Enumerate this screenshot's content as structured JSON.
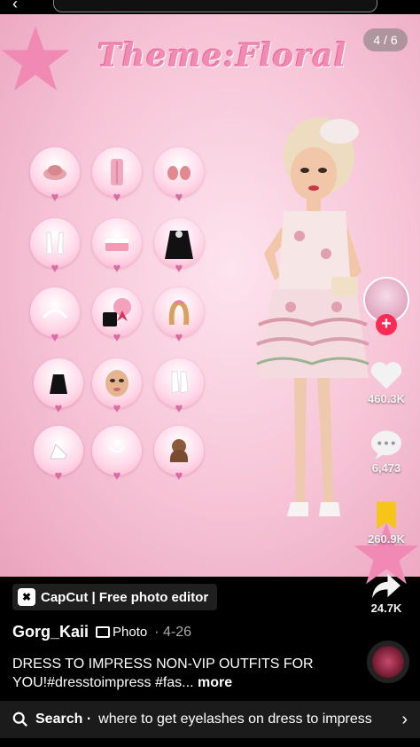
{
  "post": {
    "theme_title": "Theme:Floral",
    "page_counter": "4 / 6",
    "carousel_dots": 6,
    "carousel_active_index": 3
  },
  "rail": {
    "likes": "460.3K",
    "comments": "6,473",
    "saves": "260.9K",
    "shares": "24.7K"
  },
  "attribution": {
    "app_label": "CapCut | Free photo editor"
  },
  "meta": {
    "username": "Gorg_Kaii",
    "type_label": "Photo",
    "date": "· 4-26"
  },
  "caption": {
    "text": "DRESS TO IMPRESS NON-VIP OUTFITS FOR YOU!#dresstoimpress #fas...",
    "more": "more"
  },
  "search": {
    "label": "Search ·",
    "query": "where to get eyelashes on dress to impress"
  },
  "colors": {
    "accent_pink": "#f28ab3",
    "follow_red": "#fe2c55",
    "save_yellow": "#f5c518"
  }
}
